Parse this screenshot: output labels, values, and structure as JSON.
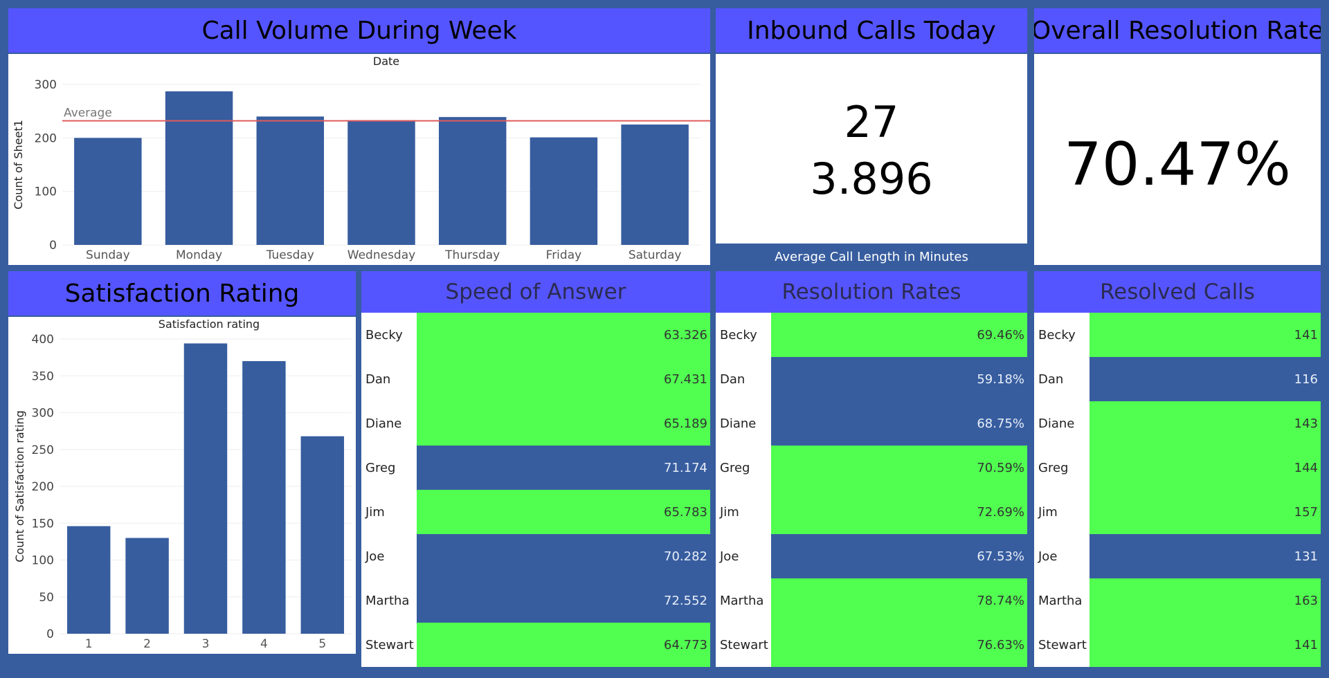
{
  "titles": {
    "call_volume": "Call Volume During Week",
    "inbound_calls": "Inbound Calls Today",
    "overall_resolution": "Overall Resolution Rate",
    "satisfaction": "Satisfaction Rating",
    "speed": "Speed of Answer",
    "resolution_rates": "Resolution Rates",
    "resolved_calls": "Resolved Calls"
  },
  "kpis": {
    "inbound_calls": "27",
    "avg_call_length": "3.896",
    "avg_call_length_caption": "Average Call Length in Minutes",
    "overall_resolution_rate": "70.47%"
  },
  "colors": {
    "title_bar": "#5555FF",
    "background": "#375D9F",
    "bar": "#375D9F",
    "highlight_green": "#50FF50",
    "average_line": "#E05A5A"
  },
  "chart_data": [
    {
      "type": "bar",
      "title": "Date",
      "xlabel": "",
      "ylabel": "Count of Sheet1",
      "categories": [
        "Sunday",
        "Monday",
        "Tuesday",
        "Wednesday",
        "Thursday",
        "Friday",
        "Saturday"
      ],
      "values": [
        200,
        287,
        240,
        233,
        239,
        201,
        225
      ],
      "ylim": [
        0,
        300
      ],
      "yticks": [
        0,
        100,
        200,
        300
      ],
      "reference_line": {
        "label": "Average",
        "value": 232
      },
      "grid": true
    },
    {
      "type": "bar",
      "title": "Satisfaction rating",
      "xlabel": "",
      "ylabel": "Count of Satisfaction rating",
      "categories": [
        "1",
        "2",
        "3",
        "4",
        "5"
      ],
      "values": [
        146,
        130,
        394,
        370,
        268
      ],
      "ylim": [
        0,
        400
      ],
      "yticks": [
        0,
        50,
        100,
        150,
        200,
        250,
        300,
        350,
        400
      ],
      "grid": true
    },
    {
      "type": "table",
      "title": "Speed of Answer",
      "rows": [
        {
          "name": "Becky",
          "value": "63.326",
          "highlight": "green"
        },
        {
          "name": "Dan",
          "value": "67.431",
          "highlight": "green"
        },
        {
          "name": "Diane",
          "value": "65.189",
          "highlight": "green"
        },
        {
          "name": "Greg",
          "value": "71.174",
          "highlight": "blue"
        },
        {
          "name": "Jim",
          "value": "65.783",
          "highlight": "green"
        },
        {
          "name": "Joe",
          "value": "70.282",
          "highlight": "blue"
        },
        {
          "name": "Martha",
          "value": "72.552",
          "highlight": "blue"
        },
        {
          "name": "Stewart",
          "value": "64.773",
          "highlight": "green"
        }
      ]
    },
    {
      "type": "table",
      "title": "Resolution Rates",
      "rows": [
        {
          "name": "Becky",
          "value": "69.46%",
          "highlight": "green"
        },
        {
          "name": "Dan",
          "value": "59.18%",
          "highlight": "blue"
        },
        {
          "name": "Diane",
          "value": "68.75%",
          "highlight": "blue"
        },
        {
          "name": "Greg",
          "value": "70.59%",
          "highlight": "green"
        },
        {
          "name": "Jim",
          "value": "72.69%",
          "highlight": "green"
        },
        {
          "name": "Joe",
          "value": "67.53%",
          "highlight": "blue"
        },
        {
          "name": "Martha",
          "value": "78.74%",
          "highlight": "green"
        },
        {
          "name": "Stewart",
          "value": "76.63%",
          "highlight": "green"
        }
      ]
    },
    {
      "type": "table",
      "title": "Resolved Calls",
      "rows": [
        {
          "name": "Becky",
          "value": "141",
          "highlight": "green"
        },
        {
          "name": "Dan",
          "value": "116",
          "highlight": "blue"
        },
        {
          "name": "Diane",
          "value": "143",
          "highlight": "green"
        },
        {
          "name": "Greg",
          "value": "144",
          "highlight": "green"
        },
        {
          "name": "Jim",
          "value": "157",
          "highlight": "green"
        },
        {
          "name": "Joe",
          "value": "131",
          "highlight": "blue"
        },
        {
          "name": "Martha",
          "value": "163",
          "highlight": "green"
        },
        {
          "name": "Stewart",
          "value": "141",
          "highlight": "green"
        }
      ]
    }
  ]
}
